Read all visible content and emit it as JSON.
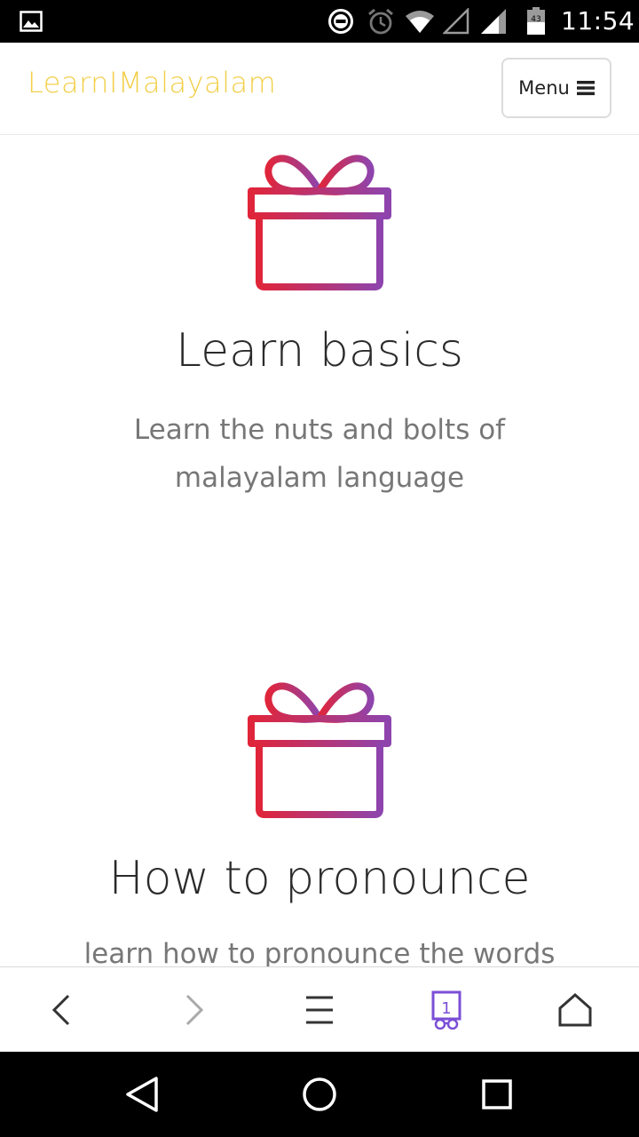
{
  "status_bar": {
    "time": "11:54",
    "battery_level": "43",
    "icons": [
      "gallery-icon",
      "do-not-disturb-icon",
      "alarm-icon",
      "wifi-icon",
      "signal-empty-icon",
      "signal-icon",
      "battery-icon"
    ]
  },
  "header": {
    "brand": "LearnIMalayalam",
    "brand_color": "#f2cf4a",
    "menu_label": "Menu",
    "menu_icon": "bars-icon"
  },
  "features": [
    {
      "icon": "gift-icon",
      "title": "Learn basics",
      "description": "Learn the nuts and bolts of malayalam language"
    },
    {
      "icon": "gift-icon",
      "title": "How to pronounce",
      "description": "learn how to pronounce the words"
    }
  ],
  "gradient": {
    "start": "#e0253a",
    "end": "#8e44ad"
  },
  "browser_toolbar": {
    "tab_count": "1",
    "active_color": "#7b4fd6",
    "buttons": [
      "back-icon",
      "forward-icon",
      "menu-icon",
      "tabs-icon",
      "home-icon"
    ]
  },
  "nav_bar": {
    "buttons": [
      "nav-back-icon",
      "nav-home-icon",
      "nav-recents-icon"
    ]
  }
}
